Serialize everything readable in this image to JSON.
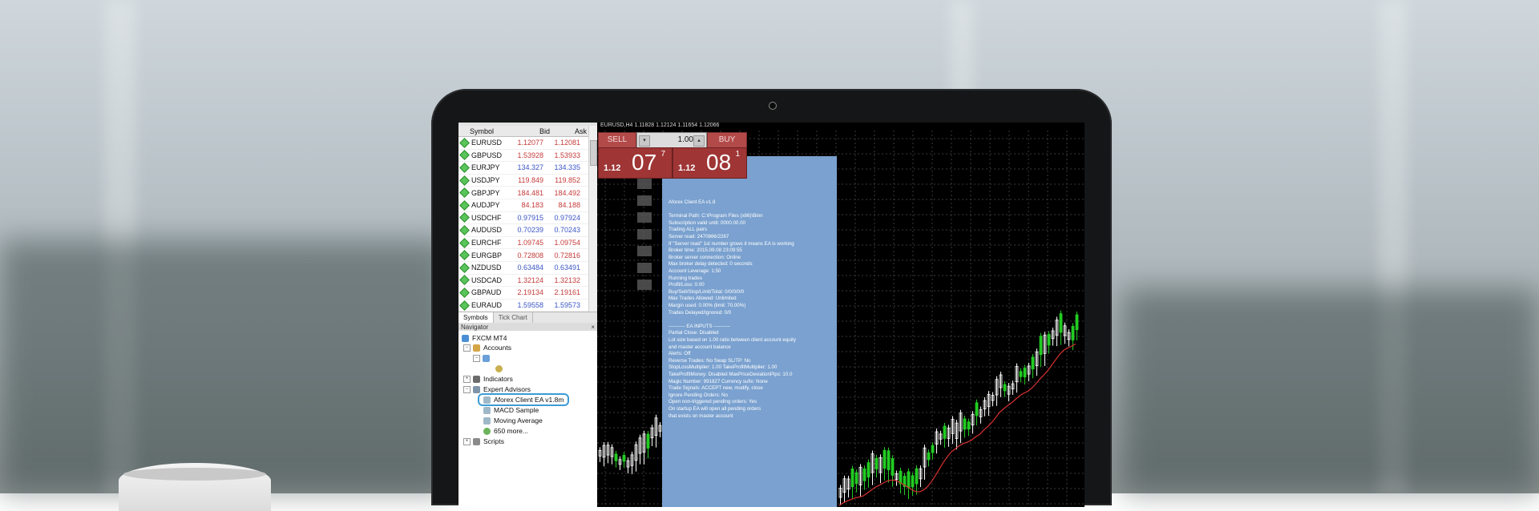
{
  "market_watch": {
    "columns": {
      "symbol": "Symbol",
      "bid": "Bid",
      "ask": "Ask"
    },
    "rows": [
      {
        "symbol": "EURUSD",
        "bid": "1.12077",
        "ask": "1.12081"
      },
      {
        "symbol": "GBPUSD",
        "bid": "1.53928",
        "ask": "1.53933"
      },
      {
        "symbol": "EURJPY",
        "bid": "134.327",
        "ask": "134.335"
      },
      {
        "symbol": "USDJPY",
        "bid": "119.849",
        "ask": "119.852"
      },
      {
        "symbol": "GBPJPY",
        "bid": "184.481",
        "ask": "184.492"
      },
      {
        "symbol": "AUDJPY",
        "bid": "84.183",
        "ask": "84.188"
      },
      {
        "symbol": "USDCHF",
        "bid": "0.97915",
        "ask": "0.97924"
      },
      {
        "symbol": "AUDUSD",
        "bid": "0.70239",
        "ask": "0.70243"
      },
      {
        "symbol": "EURCHF",
        "bid": "1.09745",
        "ask": "1.09754"
      },
      {
        "symbol": "EURGBP",
        "bid": "0.72808",
        "ask": "0.72816"
      },
      {
        "symbol": "NZDUSD",
        "bid": "0.63484",
        "ask": "0.63491"
      },
      {
        "symbol": "USDCAD",
        "bid": "1.32124",
        "ask": "1.32132"
      },
      {
        "symbol": "GBPAUD",
        "bid": "2.19134",
        "ask": "2.19161"
      },
      {
        "symbol": "EURAUD",
        "bid": "1.59558",
        "ask": "1.59573"
      }
    ],
    "tabs": [
      "Symbols",
      "Tick Chart"
    ]
  },
  "navigator": {
    "title": "Navigator",
    "close": "×",
    "root": "FXCM MT4",
    "accounts": "Accounts",
    "indicators": "Indicators",
    "expert_advisors": "Expert Advisors",
    "ea_items": [
      "Aforex Client EA v1.8m",
      "MACD Sample",
      "Moving Average",
      "650 more..."
    ],
    "scripts": "Scripts"
  },
  "chart": {
    "title": "EURUSD,H4  1.11828 1.12124 1.11654 1.12066",
    "sell_label": "SELL",
    "buy_label": "BUY",
    "lot": "1.00",
    "sell_small": "1.12",
    "sell_big": "07",
    "sell_pip": "7",
    "buy_small": "1.12",
    "buy_big": "08",
    "buy_pip": "1",
    "candle_color_up": "#22cc22",
    "candle_color_down": "#ffffff"
  },
  "ea_panel": {
    "lines": [
      "Aforex Client EA  v1.8",
      "",
      "Terminal Path: C:\\Program Files (x86)\\Binn",
      "Subscription valid until: 0000.00.00",
      "Trading ALL pairs",
      "Server read: 2470866/2267",
      "If \"Server read\" 1st number grows it means EA is working",
      "Broker time: 2015.09.08 23:09:55",
      "Broker server connection: Online",
      "Max broker delay detected: 0 seconds",
      "Account Leverage: 1:50",
      "Running trades",
      "      Profit/Loss: 0.00",
      "      Buy/Sell/Stop/Limit/Total: 0/0/0/0/0",
      "      Max Trades Allowed: Unlimited",
      "      Margin used: 0.00% (limit: 70.00%)",
      "Trades Delayed/Ignored: 0/0",
      "",
      "---------- EA INPUTS ----------",
      "Partial Close: Disabled",
      "Lot size based on 1.00 ratio between client account equity",
      "      and master account balance",
      "Alerts: Off",
      "Reverse Trades: No     Swap SL/TP: No",
      "StopLossMultiplier: 1.00      TakeProfitMultiplier: 1.00",
      "TakeProfitMoney: Disabled     MaxPriceDeviationPips: 10.0",
      "Magic Number: 991827      Currency sufix: None",
      "Trade Signals: ACCEPT new, modify, close",
      "Ignore Pending Orders: No",
      "Open non-triggered pending orders: Yes",
      "      On startup EA will open all pending orders",
      "      that exists on master account"
    ]
  }
}
